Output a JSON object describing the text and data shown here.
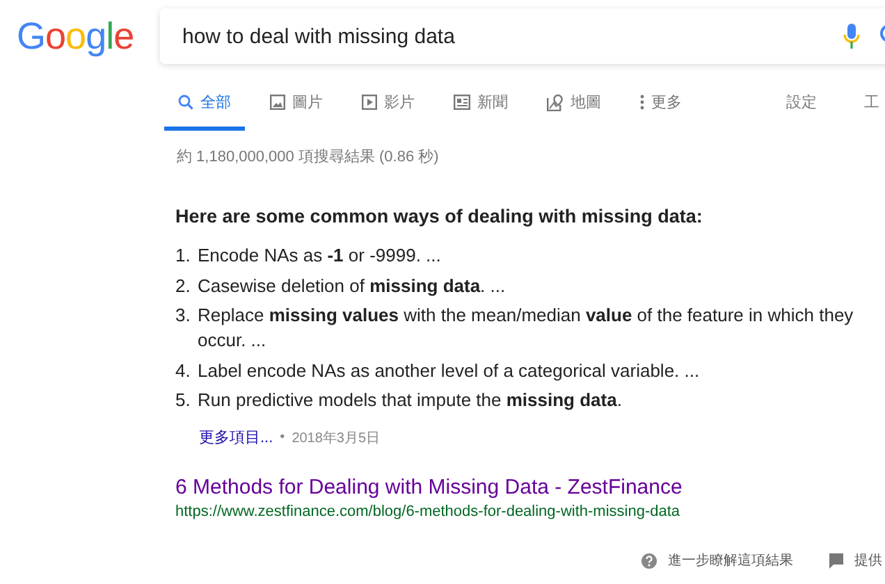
{
  "logo": {
    "text": "Google"
  },
  "search": {
    "value": "how to deal with missing data"
  },
  "tabs": [
    {
      "label": "全部",
      "selected": true
    },
    {
      "label": "圖片",
      "selected": false
    },
    {
      "label": "影片",
      "selected": false
    },
    {
      "label": "新聞",
      "selected": false
    },
    {
      "label": "地圖",
      "selected": false
    },
    {
      "label": "更多",
      "selected": false
    }
  ],
  "tools": [
    "設定",
    "工"
  ],
  "result_stats": "約 1,180,000,000 項搜尋結果 (0.86 秒)",
  "snippet": {
    "heading": "Here are some common ways of dealing with missing data:",
    "items": [
      {
        "marker": "1.",
        "text": "Encode NAs as **-1** or -9999. ..."
      },
      {
        "marker": "2.",
        "text": "Casewise deletion of **missing data**. ..."
      },
      {
        "marker": "3.",
        "text": "Replace **missing values** with the mean/median **value** of the feature in which they occur. ..."
      },
      {
        "marker": "4.",
        "text": "Label encode NAs as another level of a categorical variable. ..."
      },
      {
        "marker": "5.",
        "text": "Run predictive models that impute the **missing data**."
      }
    ],
    "more": "更多項目...",
    "separator": "•",
    "date": "2018年3月5日"
  },
  "result": {
    "title": "6 Methods for Dealing with Missing Data - ZestFinance",
    "url": "https://www.zestfinance.com/blog/6-methods-for-dealing-with-missing-data"
  },
  "footer": {
    "about": "進一步瞭解這項結果",
    "feedback": "提供"
  }
}
